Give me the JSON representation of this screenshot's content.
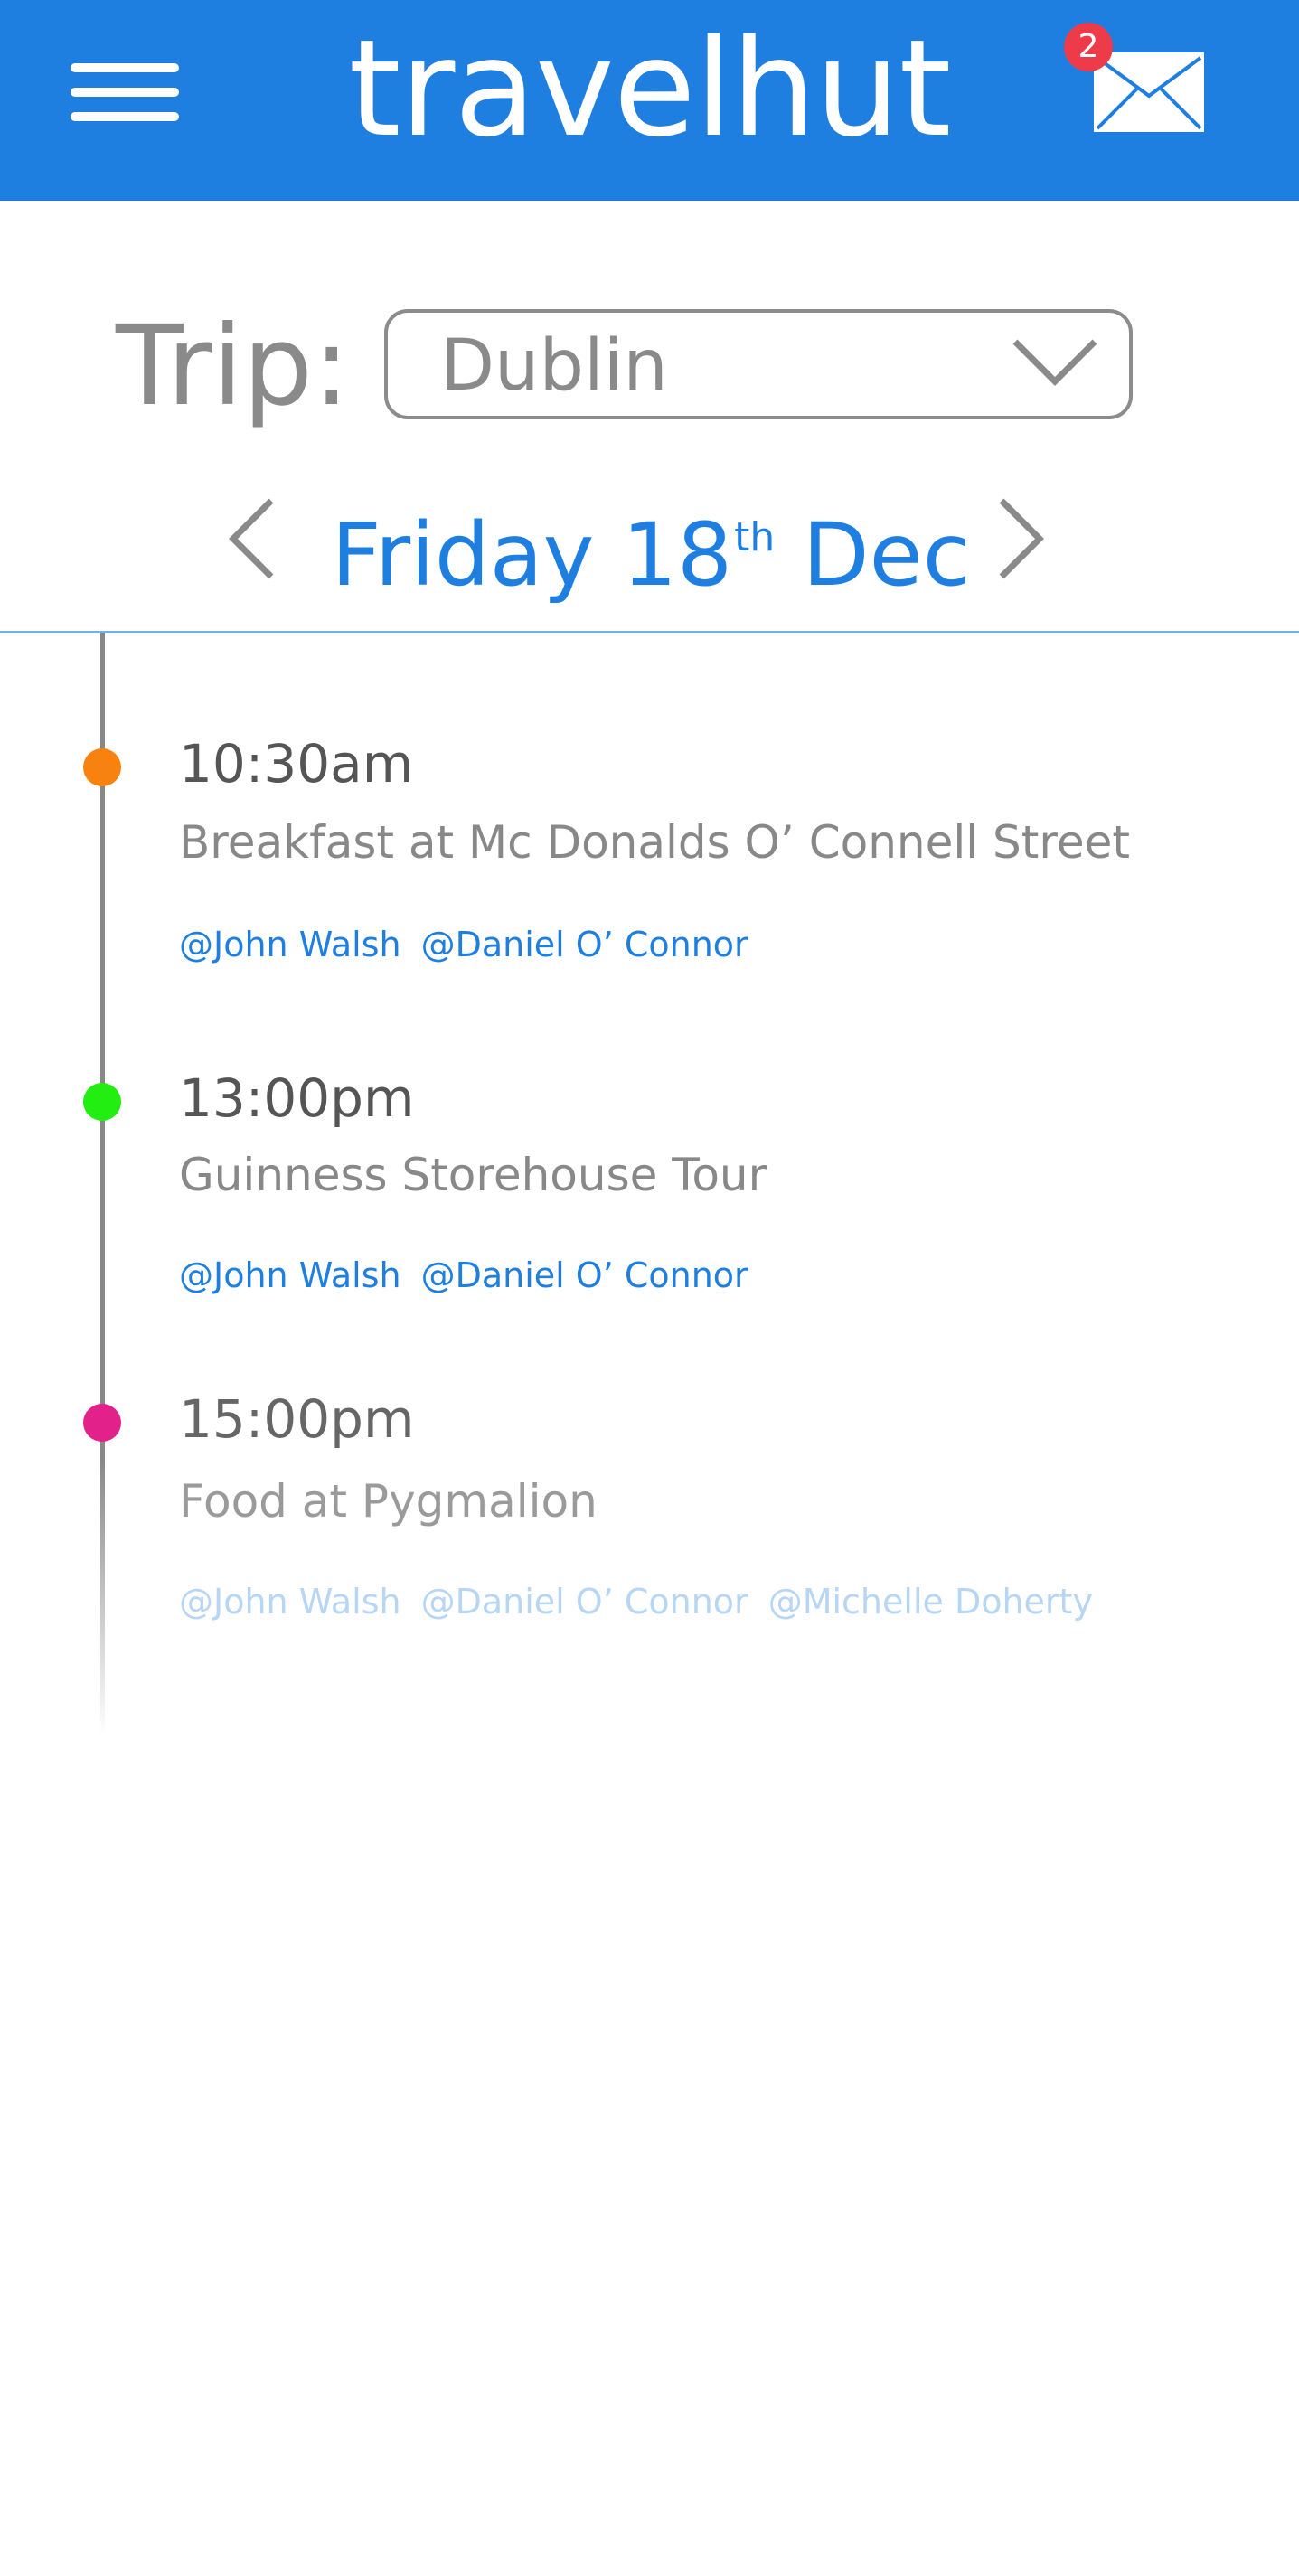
{
  "header": {
    "brand": "travelhut",
    "mail_badge_count": "2",
    "bg_color": "#1f7fe0"
  },
  "trip": {
    "label": "Trip:",
    "selected": "Dublin"
  },
  "date_nav": {
    "day": "Friday 18",
    "suffix": "th",
    "month": "Dec"
  },
  "events": [
    {
      "time": "10:30am",
      "title": "Breakfast at Mc Donalds O’ Connell Street",
      "dot_color": "#f7820f",
      "tags": [
        "@John Walsh",
        "@Daniel O’ Connor"
      ]
    },
    {
      "time": "13:00pm",
      "title": "Guinness Storehouse Tour",
      "dot_color": "#22ee11",
      "tags": [
        "@John Walsh",
        "@Daniel O’ Connor"
      ]
    },
    {
      "time": "15:00pm",
      "title": "Food at Pygmalion",
      "dot_color": "#e3218a",
      "tags": [
        "@John Walsh",
        "@Daniel O’ Connor",
        "@Michelle Doherty"
      ]
    }
  ]
}
